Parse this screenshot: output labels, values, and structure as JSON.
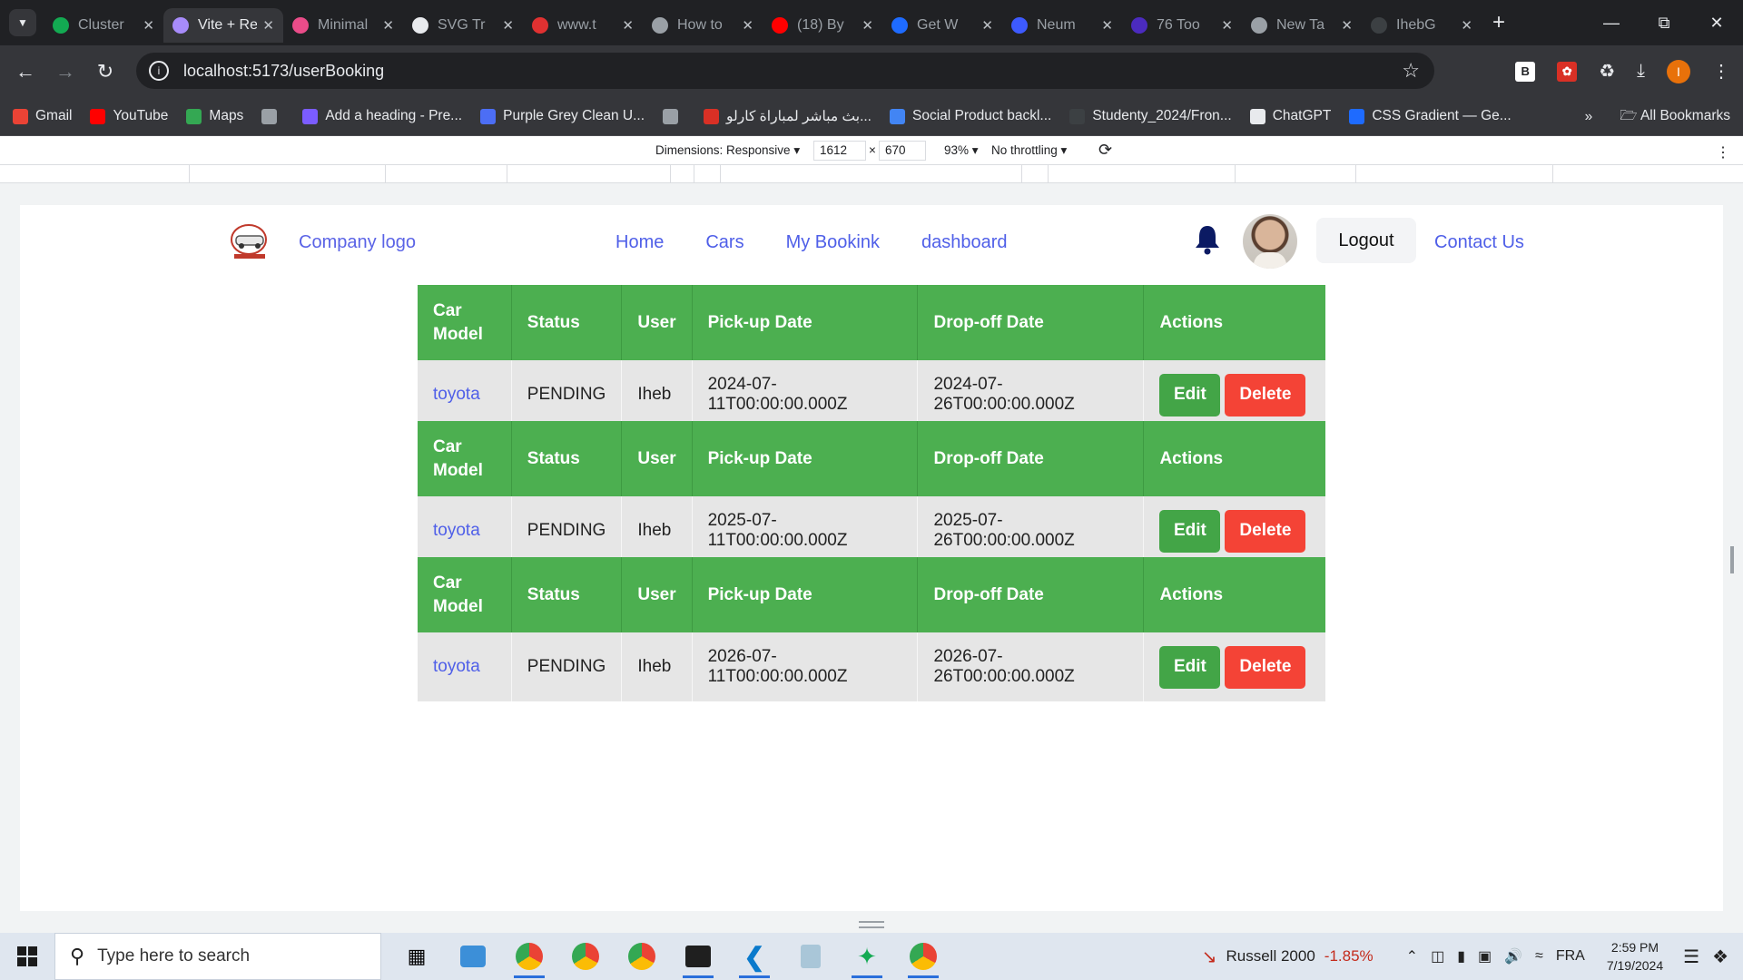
{
  "browser": {
    "tabs": [
      {
        "title": "Cluster",
        "color": "#13aa52",
        "active": false
      },
      {
        "title": "Vite + React",
        "color": "#a78bfa",
        "active": true
      },
      {
        "title": "Minimal",
        "color": "#ea4c89",
        "active": false
      },
      {
        "title": "SVG Tr",
        "color": "#e8eaed",
        "active": false
      },
      {
        "title": "www.t",
        "color": "#e03131",
        "active": false
      },
      {
        "title": "How to",
        "color": "#9aa0a6",
        "active": false
      },
      {
        "title": "(18) By",
        "color": "#ff0000",
        "active": false
      },
      {
        "title": "Get W",
        "color": "#1e6bff",
        "active": false
      },
      {
        "title": "Neum",
        "color": "#3d5afe",
        "active": false
      },
      {
        "title": "76 Too",
        "color": "#4b2bbf",
        "active": false
      },
      {
        "title": "New Ta",
        "color": "#9aa0a6",
        "active": false
      },
      {
        "title": "IhebG",
        "color": "#3c4043",
        "active": false
      }
    ],
    "new_tab": "+",
    "url": "localhost:5173/userBooking",
    "bookmarks": [
      {
        "label": "Gmail",
        "color": "#ea4335"
      },
      {
        "label": "YouTube",
        "color": "#ff0000"
      },
      {
        "label": "Maps",
        "color": "#34a853"
      },
      {
        "label": "",
        "color": "#9aa0a6"
      },
      {
        "label": "Add a heading - Pre...",
        "color": "#7b5cff"
      },
      {
        "label": "Purple Grey Clean U...",
        "color": "#4c6ef5"
      },
      {
        "label": "",
        "color": "#9aa0a6"
      },
      {
        "label": "بث مباشر لمباراة كارلو...",
        "color": "#d93025"
      },
      {
        "label": "Social Product backl...",
        "color": "#4285f4"
      },
      {
        "label": "Studenty_2024/Fron...",
        "color": "#3c4043"
      },
      {
        "label": "ChatGPT",
        "color": "#e8eaed"
      },
      {
        "label": "CSS Gradient — Ge...",
        "color": "#1e6bff"
      }
    ],
    "all_bookmarks": "All Bookmarks",
    "profile_initial": "I",
    "ext_b": "B"
  },
  "devtools": {
    "dimensions_label": "Dimensions: Responsive",
    "width": "1612",
    "times": "×",
    "height": "670",
    "zoom": "93%",
    "throttling": "No throttling"
  },
  "app": {
    "logo_text": "Company logo",
    "nav": [
      "Home",
      "Cars",
      "My Bookink",
      "dashboard"
    ],
    "logout": "Logout",
    "contact": "Contact Us",
    "headers": [
      "Car Model",
      "Status",
      "User",
      "Pick-up Date",
      "Drop-off Date",
      "Actions"
    ],
    "edit_label": "Edit",
    "delete_label": "Delete",
    "bookings": [
      {
        "model": "toyota",
        "status": "PENDING",
        "user": "Iheb",
        "pickup": "2024-07-11T00:00:00.000Z",
        "dropoff": "2024-07-26T00:00:00.000Z"
      },
      {
        "model": "toyota",
        "status": "PENDING",
        "user": "Iheb",
        "pickup": "2025-07-11T00:00:00.000Z",
        "dropoff": "2025-07-26T00:00:00.000Z"
      },
      {
        "model": "toyota",
        "status": "PENDING",
        "user": "Iheb",
        "pickup": "2026-07-11T00:00:00.000Z",
        "dropoff": "2026-07-26T00:00:00.000Z"
      }
    ]
  },
  "taskbar": {
    "search_placeholder": "Type here to search",
    "stock_name": "Russell 2000",
    "stock_change": "-1.85%",
    "language": "FRA",
    "time": "2:59 PM",
    "date": "7/19/2024"
  }
}
